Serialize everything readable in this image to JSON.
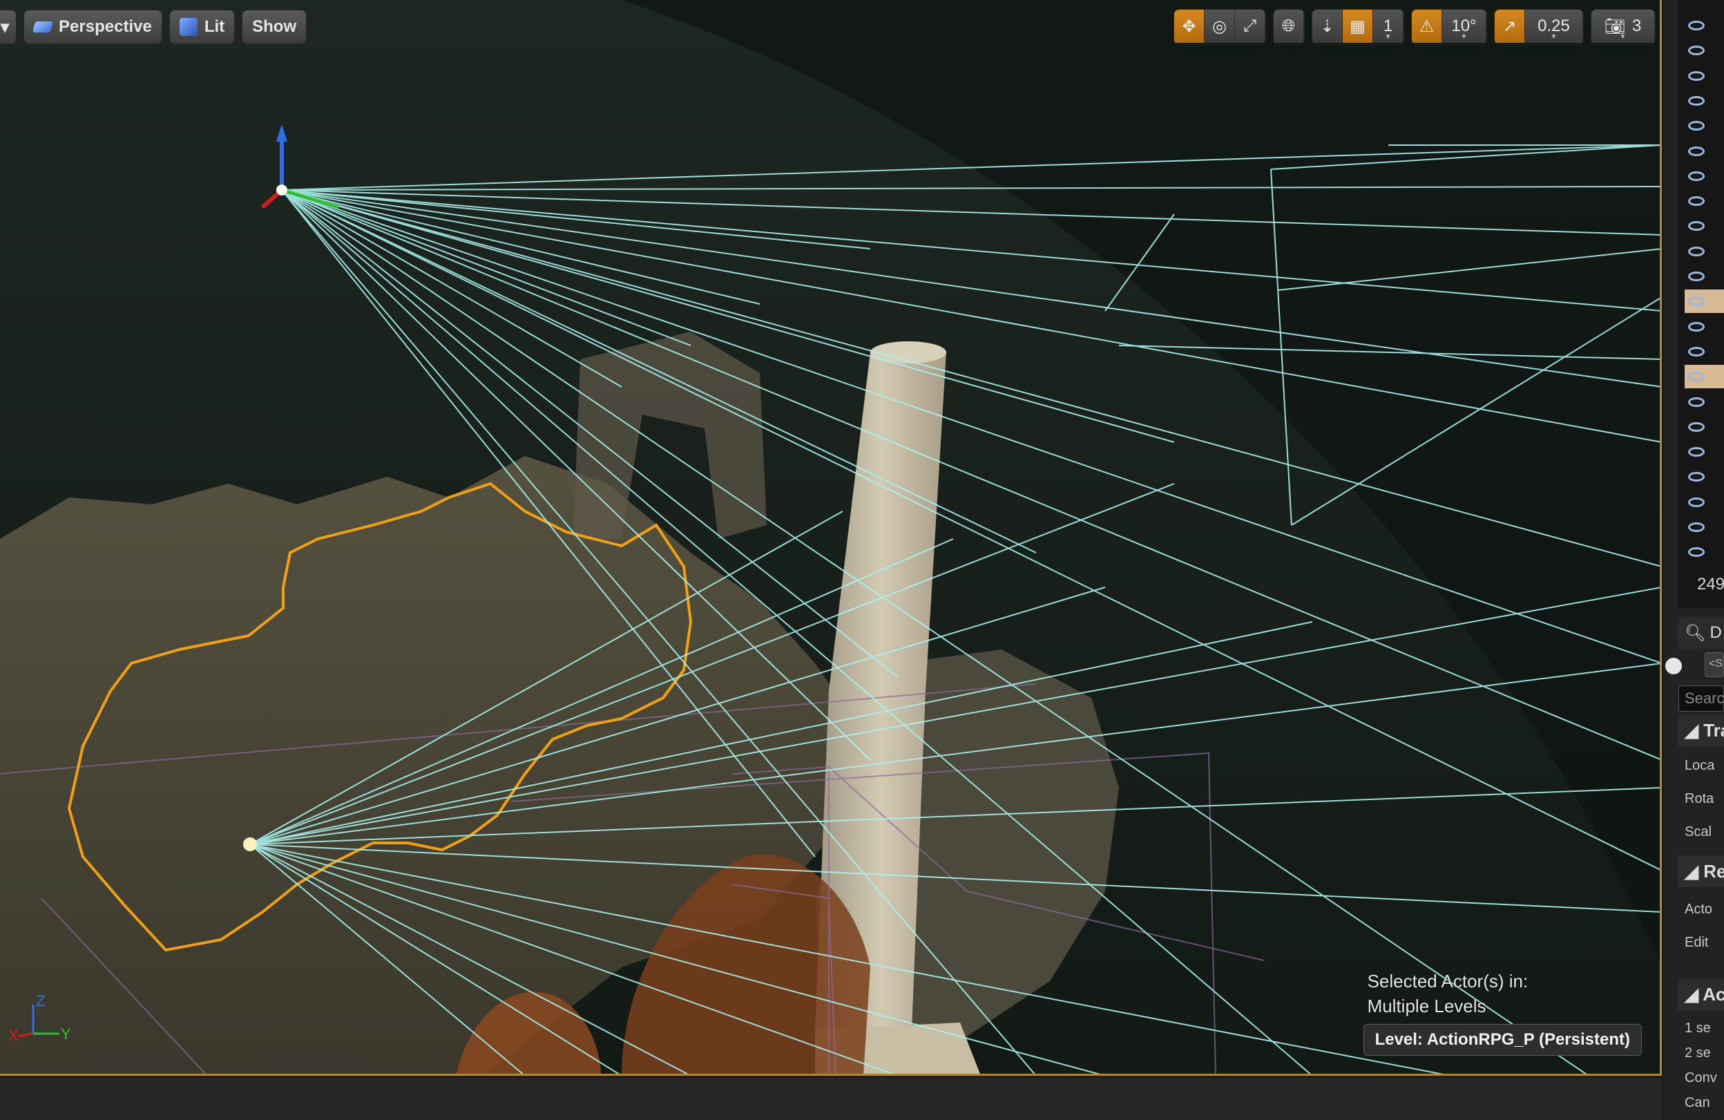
{
  "toolbar": {
    "view_mode": "Perspective",
    "lighting": "Lit",
    "show": "Show",
    "grid_snap_value": "1",
    "rotation_snap_value": "10°",
    "scale_snap_value": "0.25",
    "camera_speed": "3"
  },
  "overlay": {
    "selected_text_line1": "Selected Actor(s) in:",
    "selected_text_line2": "Multiple Levels",
    "level_badge": "Level:  ActionRPG_P (Persistent)"
  },
  "axis": {
    "x": "X",
    "y": "Y",
    "z": "Z"
  },
  "outliner": {
    "eye_rows": 22,
    "highlighted_rows": [
      11,
      14
    ],
    "count_text": "249"
  },
  "details": {
    "tab_label": "D",
    "mobility_btn": "<S",
    "search_placeholder": "Search",
    "sections": {
      "transform": "Tran",
      "rendering": "Ren",
      "actor": "Acto"
    },
    "transform_rows": [
      "Loca",
      "Rota",
      "Scal"
    ],
    "rendering_rows": [
      "Acto",
      "Edit"
    ],
    "actor_rows": [
      "1 se",
      "2 se",
      "Conv",
      "Can"
    ]
  },
  "colors": {
    "accent_orange": "#c98517",
    "wire_cyan": "#a9f2ee",
    "selection_outline": "#f0a015"
  }
}
